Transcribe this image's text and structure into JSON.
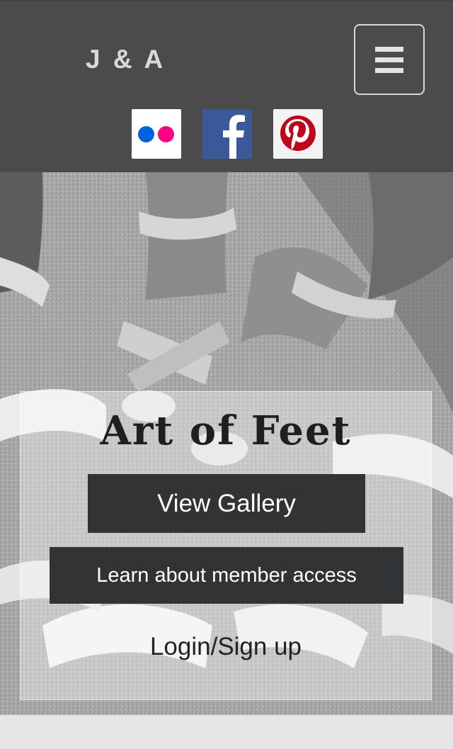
{
  "header": {
    "logo_text": "J & A",
    "menu_icon": "hamburger-menu-icon",
    "social": [
      {
        "name": "flickr",
        "icon": "flickr-icon"
      },
      {
        "name": "facebook",
        "icon": "facebook-icon"
      },
      {
        "name": "pinterest",
        "icon": "pinterest-icon"
      }
    ]
  },
  "hero": {
    "image": "black-and-white photo of feet in sandals",
    "title": "Art of Feet",
    "buttons": {
      "gallery_label": "View Gallery",
      "member_label": "Learn about member access"
    },
    "login_label": "Login/Sign up"
  },
  "colors": {
    "header_bg": "#4c4b4c",
    "button_bg": "#323335",
    "footer_bg": "#e6e6e6",
    "flickr_blue": "#0063dc",
    "flickr_pink": "#ff0084",
    "facebook_blue": "#3b5998",
    "pinterest_red": "#bd081c"
  }
}
